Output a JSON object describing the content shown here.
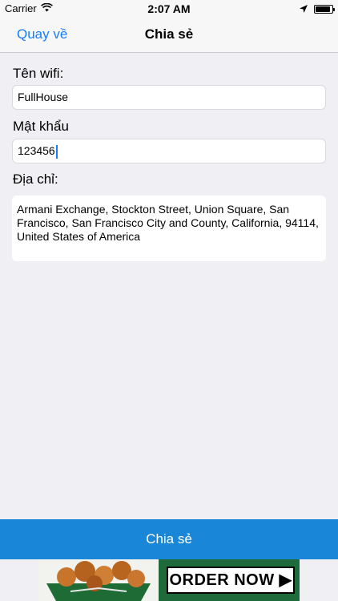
{
  "status_bar": {
    "carrier": "Carrier",
    "time": "2:07 AM",
    "battery_level": 0.9
  },
  "nav": {
    "back_label": "Quay về",
    "title": "Chia sẻ"
  },
  "form": {
    "wifi_name_label": "Tên wifi:",
    "wifi_name_value": "FullHouse",
    "password_label": "Mật khẩu",
    "password_value": "123456",
    "address_label": "Địa chỉ:",
    "address_value": "Armani Exchange, Stockton Street, Union Square, San Francisco, San Francisco City and County, California, 94114, United States of America"
  },
  "share_button_label": "Chia sẻ",
  "ad": {
    "cta_label": "ORDER NOW"
  },
  "colors": {
    "accent": "#147efb",
    "share_button": "#1a86d8",
    "background": "#efeff4"
  }
}
